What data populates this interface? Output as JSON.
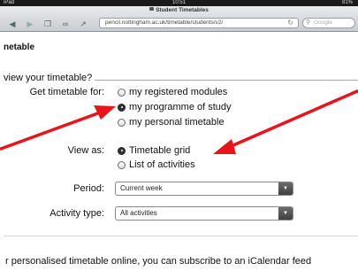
{
  "status_bar": {
    "device": "iPad",
    "time": "10:51",
    "battery": "81%"
  },
  "browser": {
    "page_title": "Student Timetables",
    "url": "pencil.nottingham.ac.uk/timetable/students/v2/",
    "search_placeholder": "Google"
  },
  "page": {
    "heading": "netable",
    "legend": "view your timetable?",
    "timetable_for": {
      "label": "Get timetable for:",
      "options": [
        "my registered modules",
        "my programme of study",
        "my personal timetable"
      ],
      "selected": "my programme of study"
    },
    "view_as": {
      "label": "View as:",
      "options": [
        "Timetable grid",
        "List of activities"
      ],
      "selected": "Timetable grid"
    },
    "period": {
      "label": "Period:",
      "value": "Current week"
    },
    "activity_type": {
      "label": "Activity type:",
      "value": "All activities"
    },
    "footer_text": "r personalised timetable online, you can subscribe to an iCalendar feed"
  },
  "colors": {
    "annotation_arrow": "#e8131b",
    "select_arrow_bg": "#4a4a4a"
  }
}
